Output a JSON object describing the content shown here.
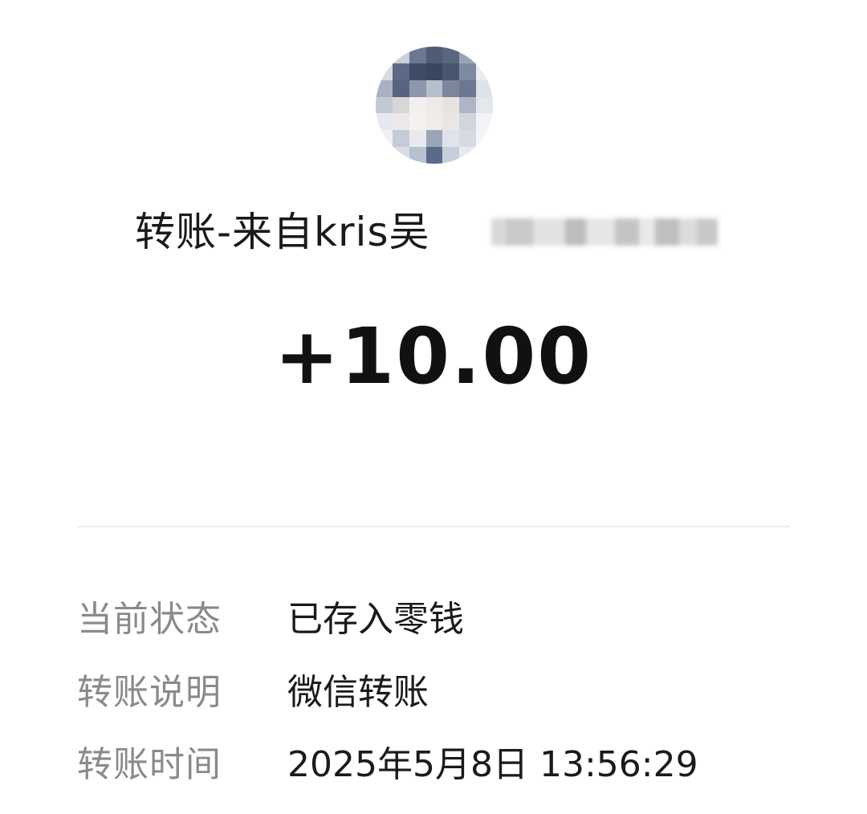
{
  "header": {
    "avatar_icon": "user-avatar-pixelated",
    "title": "转账-来自kris吴"
  },
  "amount": "+10.00",
  "details": [
    {
      "label": "当前状态",
      "value": "已存入零钱"
    },
    {
      "label": "转账说明",
      "value": "微信转账"
    },
    {
      "label": "转账时间",
      "value": "2025年5月8日 13:56:29"
    }
  ],
  "colors": {
    "label": "#8a8a8a",
    "value": "#1a1a1a",
    "amount": "#111111",
    "divider": "#ececec"
  }
}
